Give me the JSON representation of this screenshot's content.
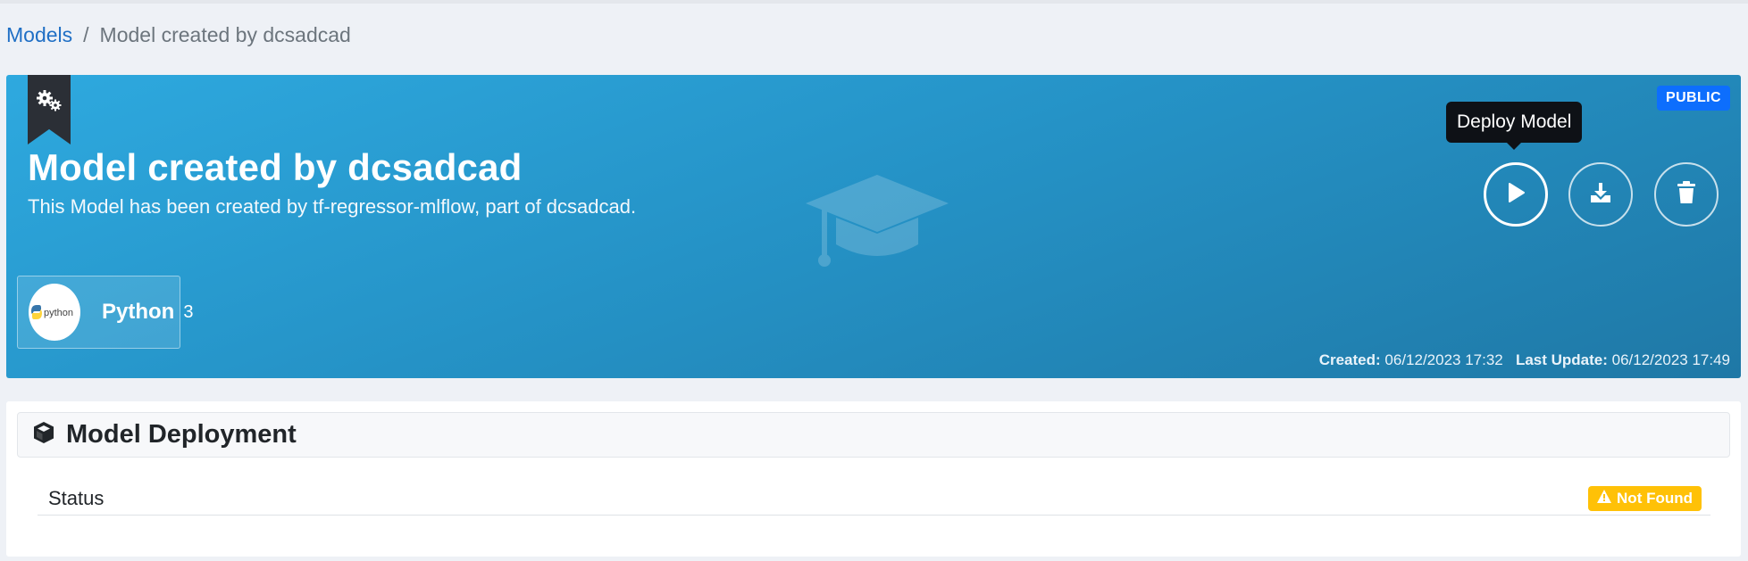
{
  "breadcrumb": {
    "root": "Models",
    "separator": "/",
    "current": "Model created by dcsadcad"
  },
  "hero": {
    "title": "Model created by dcsadcad",
    "subtitle": "This Model has been created by tf-regressor-mlflow, part of dcsadcad.",
    "visibility_badge": "PUBLIC",
    "ribbon_icon": "gears-icon",
    "watermark_icon": "graduation-cap-icon",
    "tooltip": "Deploy Model",
    "actions": [
      {
        "name": "deploy",
        "icon": "play-icon"
      },
      {
        "name": "download",
        "icon": "download-icon"
      },
      {
        "name": "delete",
        "icon": "trash-icon"
      }
    ],
    "technology": {
      "logo_text": "python",
      "name": "Python",
      "version": "3"
    },
    "created_label": "Created:",
    "created_value": "06/12/2023 17:32",
    "updated_label": "Last Update:",
    "updated_value": "06/12/2023 17:49"
  },
  "deployment": {
    "title": "Model Deployment",
    "icon": "cube-icon",
    "status_label": "Status",
    "status_value": "Not Found",
    "status_color": "#ffc107"
  },
  "colors": {
    "hero_start": "#2ea9df",
    "hero_end": "#1f78a6",
    "link": "#1f6fc5",
    "public_badge": "#0d6efd"
  }
}
